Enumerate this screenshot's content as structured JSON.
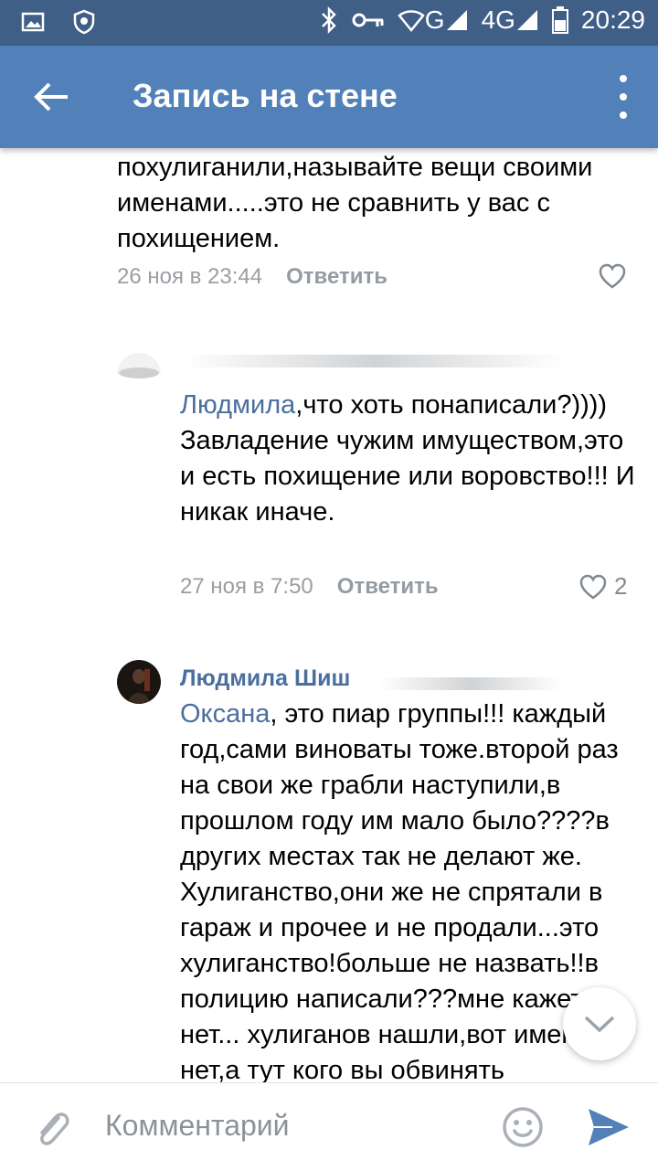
{
  "status_bar": {
    "network_2g": "G",
    "network_4g": "4G",
    "time": "20:29"
  },
  "toolbar": {
    "title": "Запись на стене"
  },
  "comments": [
    {
      "text": "похулиганили,называйте вещи своими именами.....это не сравнить у вас с похищением.",
      "date": "26 ноя в 23:44",
      "reply": "Ответить",
      "likes": ""
    },
    {
      "author": "",
      "mention": "Людмила",
      "text": ",что хоть понаписали?)))) Завладение чужим имуществом,это и есть похищение или воровство!!! И никак иначе.",
      "date": "27 ноя в 7:50",
      "reply": "Ответить",
      "likes": "2"
    },
    {
      "author": "Людмила Шиш",
      "mention": "Оксана",
      "text": ", это пиар группы!!! каждый год,сами виноваты тоже.второй раз на свои же грабли наступили,в прошлом году им мало было????в других местах так не делают же. Хулиганство,они же не спрятали  в гараж и прочее и не продали...это хулиганство!больше не назвать!!в полицию написали???мне кажется нет... хулиганов нашли,вот имени нет,а тут кого вы обвинять"
    }
  ],
  "composer": {
    "placeholder": "Комментарий"
  },
  "colors": {
    "status_bar": "#3f5f86",
    "toolbar": "#5181b8",
    "link": "#4a6f9f",
    "meta": "#9a9ea3"
  }
}
